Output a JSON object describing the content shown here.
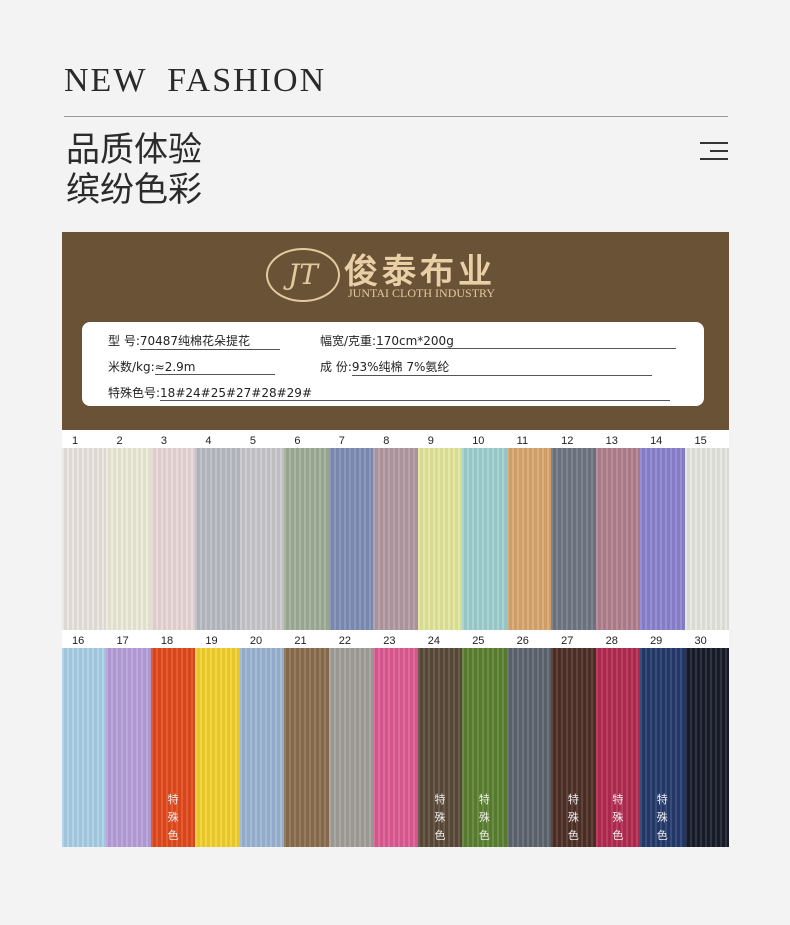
{
  "header": {
    "headline": "NEW FASHION",
    "tagline_1": "品质体验",
    "tagline_2": "缤纷色彩"
  },
  "brand": {
    "logo_text": "JT",
    "name_cn": "俊泰布业",
    "name_en": "JUNTAI CLOTH INDUSTRY"
  },
  "spec": {
    "model_label": "型    号:",
    "model_value": "70487纯棉花朵提花",
    "width_label": "幅宽/克重:",
    "width_value": "170cm*200g",
    "meter_label": "米数/kg:",
    "meter_value": "≈2.9m",
    "comp_label": "成    份:",
    "comp_value": "93%纯棉 7%氨纶",
    "special_label": "特殊色号:",
    "special_value": "18#24#25#27#28#29#"
  },
  "swatches_row1": [
    {
      "num": "1",
      "color": "#e9e4df"
    },
    {
      "num": "2",
      "color": "#ecead8"
    },
    {
      "num": "3",
      "color": "#e8d7d6"
    },
    {
      "num": "4",
      "color": "#b9bcc3"
    },
    {
      "num": "5",
      "color": "#c8c8cc"
    },
    {
      "num": "6",
      "color": "#9fae98"
    },
    {
      "num": "7",
      "color": "#7e8fb5"
    },
    {
      "num": "8",
      "color": "#b29aa2"
    },
    {
      "num": "9",
      "color": "#e2e69a"
    },
    {
      "num": "10",
      "color": "#9fcfcf"
    },
    {
      "num": "11",
      "color": "#d9a66e"
    },
    {
      "num": "12",
      "color": "#6f7784"
    },
    {
      "num": "13",
      "color": "#b1808f"
    },
    {
      "num": "14",
      "color": "#8a82cf"
    },
    {
      "num": "15",
      "color": "#e6e6df"
    }
  ],
  "swatches_row2": [
    {
      "num": "16",
      "color": "#a9cfe6",
      "label": ""
    },
    {
      "num": "17",
      "color": "#b79fd9",
      "label": ""
    },
    {
      "num": "18",
      "color": "#e2491c",
      "label": "特殊色"
    },
    {
      "num": "19",
      "color": "#f2d12c",
      "label": ""
    },
    {
      "num": "20",
      "color": "#9bb4d4",
      "label": ""
    },
    {
      "num": "21",
      "color": "#8b6e4e",
      "label": ""
    },
    {
      "num": "22",
      "color": "#a29e99",
      "label": ""
    },
    {
      "num": "23",
      "color": "#dd5b92",
      "label": ""
    },
    {
      "num": "24",
      "color": "#5b4a39",
      "label": "特殊色"
    },
    {
      "num": "25",
      "color": "#5a8030",
      "label": "特殊色"
    },
    {
      "num": "26",
      "color": "#5d6570",
      "label": ""
    },
    {
      "num": "27",
      "color": "#4e3027",
      "label": "特殊色"
    },
    {
      "num": "28",
      "color": "#b22a50",
      "label": "特殊色"
    },
    {
      "num": "29",
      "color": "#243a6c",
      "label": "特殊色"
    },
    {
      "num": "30",
      "color": "#181c2a",
      "label": ""
    }
  ]
}
